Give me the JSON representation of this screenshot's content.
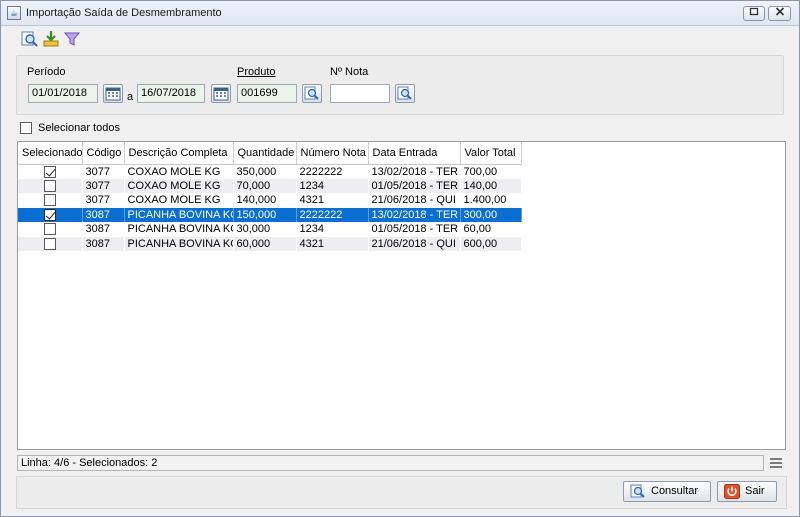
{
  "window": {
    "title": "Importação Saída de Desmembramento"
  },
  "filters": {
    "periodo_label": "Período",
    "date_from": "01/01/2018",
    "date_sep": "a",
    "date_to": "16/07/2018",
    "produto_label": "Produto",
    "produto_value": "001699",
    "nota_label": "Nº Nota",
    "nota_value": ""
  },
  "select_all_label": "Selecionar todos",
  "table": {
    "columns": [
      "Selecionado",
      "Código",
      "Descrição Completa",
      "Quantidade",
      "Número Nota",
      "Data Entrada",
      "Valor Total"
    ],
    "rows": [
      {
        "checked": true,
        "codigo": "3077",
        "descricao": "COXAO MOLE KG",
        "quantidade": "350,000",
        "nota": "2222222",
        "data": "13/02/2018 - TER",
        "valor": "700,00"
      },
      {
        "checked": false,
        "codigo": "3077",
        "descricao": "COXAO MOLE KG",
        "quantidade": "70,000",
        "nota": "1234",
        "data": "01/05/2018 - TER",
        "valor": "140,00"
      },
      {
        "checked": false,
        "codigo": "3077",
        "descricao": "COXAO MOLE KG",
        "quantidade": "140,000",
        "nota": "4321",
        "data": "21/06/2018 - QUI",
        "valor": "1.400,00"
      },
      {
        "checked": true,
        "codigo": "3087",
        "descricao": "PICANHA BOVINA KG",
        "quantidade": "150,000",
        "nota": "2222222",
        "data": "13/02/2018 - TER",
        "valor": "300,00"
      },
      {
        "checked": false,
        "codigo": "3087",
        "descricao": "PICANHA BOVINA KG",
        "quantidade": "30,000",
        "nota": "1234",
        "data": "01/05/2018 - TER",
        "valor": "60,00"
      },
      {
        "checked": false,
        "codigo": "3087",
        "descricao": "PICANHA BOVINA KG",
        "quantidade": "60,000",
        "nota": "4321",
        "data": "21/06/2018 - QUI",
        "valor": "600,00"
      }
    ],
    "selected_row_index": 3
  },
  "status_text": "Linha: 4/6 - Selecionados: 2",
  "buttons": {
    "consultar": "Consultar",
    "sair": "Sair"
  },
  "colors": {
    "selection": "#0a6fd1",
    "field_bg": "#e9f5e9",
    "sair_icon": "#e0502a"
  }
}
